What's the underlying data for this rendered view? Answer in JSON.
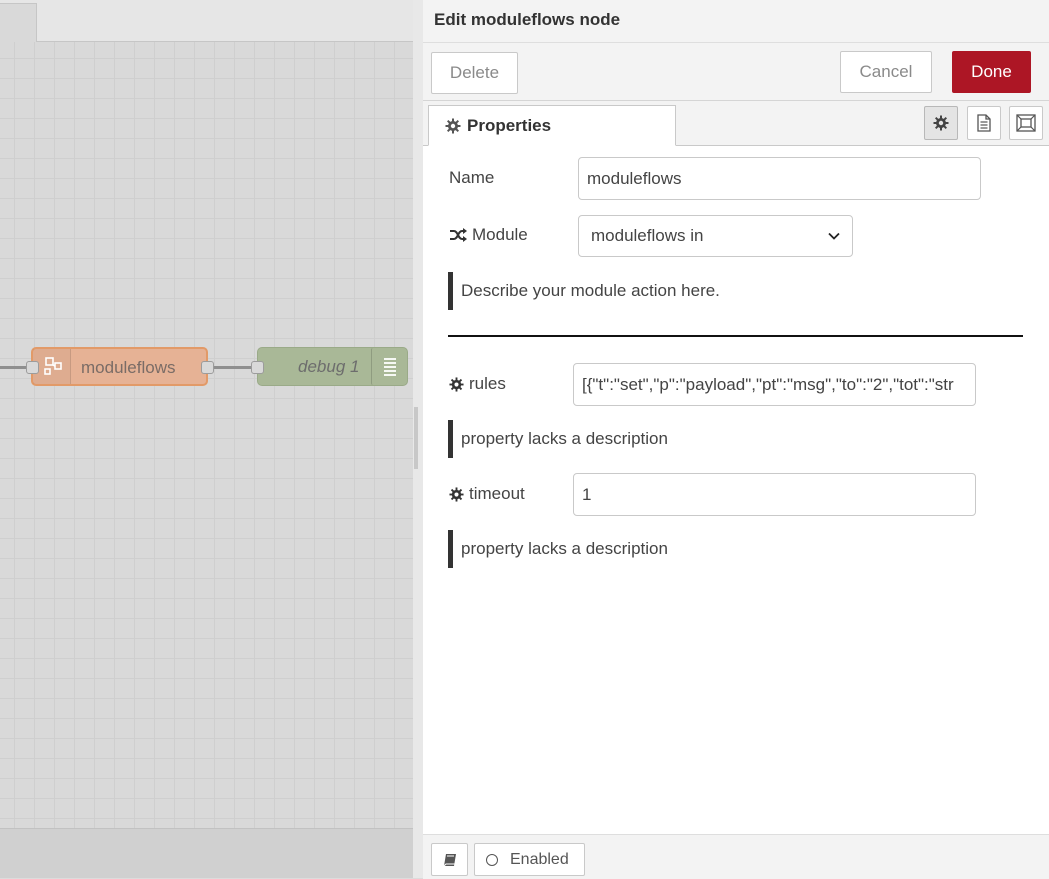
{
  "canvas": {
    "nodes": [
      {
        "label": "moduleflows",
        "icon": "module-icon",
        "color": "#e6b295"
      },
      {
        "label": "debug 1",
        "icon": "list-icon",
        "color": "#a9b897"
      }
    ]
  },
  "tray": {
    "title": "Edit moduleflows node",
    "toolbar": {
      "delete_label": "Delete",
      "cancel_label": "Cancel",
      "done_label": "Done"
    },
    "tabs": {
      "properties_label": "Properties",
      "icons": [
        "gear-icon",
        "document-icon",
        "frame-icon"
      ]
    },
    "form": {
      "name_label": "Name",
      "name_value": "moduleflows",
      "module_label": "Module",
      "module_value": "moduleflows in",
      "module_description": "Describe your module action here.",
      "rules_label": "rules",
      "rules_value": "[{\"t\":\"set\",\"p\":\"payload\",\"pt\":\"msg\",\"to\":\"2\",\"tot\":\"str",
      "rules_description": "property lacks a description",
      "timeout_label": "timeout",
      "timeout_value": "1",
      "timeout_description": "property lacks a description"
    },
    "footer": {
      "enabled_label": "Enabled"
    }
  },
  "colors": {
    "done_button": "#ad1625",
    "node_moduleflows": "#e6b295",
    "node_debug": "#a9b897"
  }
}
